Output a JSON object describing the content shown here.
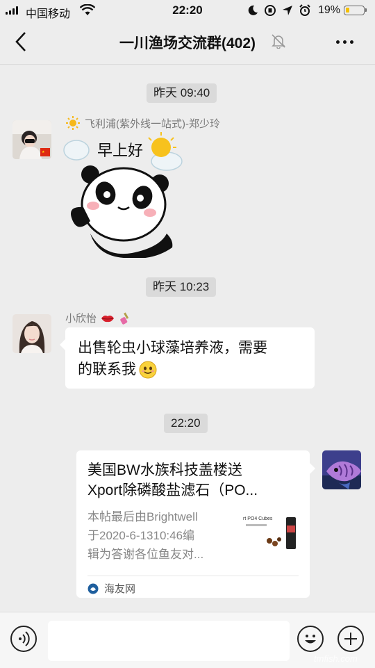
{
  "status_bar": {
    "carrier": "中国移动",
    "time": "22:20",
    "battery_percent": "19%",
    "battery_level": 0.19
  },
  "nav": {
    "title": "一川渔场交流群(402)",
    "back_icon": "chevron-left-icon",
    "mute_icon": "bell-off-icon",
    "more_icon": "more-dots-icon"
  },
  "messages": {
    "ts1": "昨天 09:40",
    "m1_sender": "飞利浦(紫外线一站式)-郑少玲",
    "m1_sticker_text": "早上好",
    "ts2": "昨天 10:23",
    "m2_sender": "小欣怡",
    "m2_line1": "出售轮虫小球藻培养液，需要",
    "m2_line2": "的联系我",
    "ts3": "22:20",
    "card_title_1": "美国BW水族科技盖楼送",
    "card_title_2": "Xport除磷酸盐滤石（PO...",
    "card_desc_1": "本帖最后由Brightwell",
    "card_desc_2": "于2020-6-1310:46编",
    "card_desc_3": "辑为答谢各位鱼友对...",
    "card_thumb_text": "rt PO4 Cubes",
    "card_source": "海友网"
  },
  "input_bar": {
    "voice_icon": "voice-icon",
    "emoji_icon": "emoji-icon",
    "plus_icon": "plus-icon"
  },
  "watermark": "tmfish.com",
  "colors": {
    "background": "#ededed",
    "bubble": "#ffffff",
    "timestamp_bg": "#dadada",
    "battery": "#f5c000"
  }
}
